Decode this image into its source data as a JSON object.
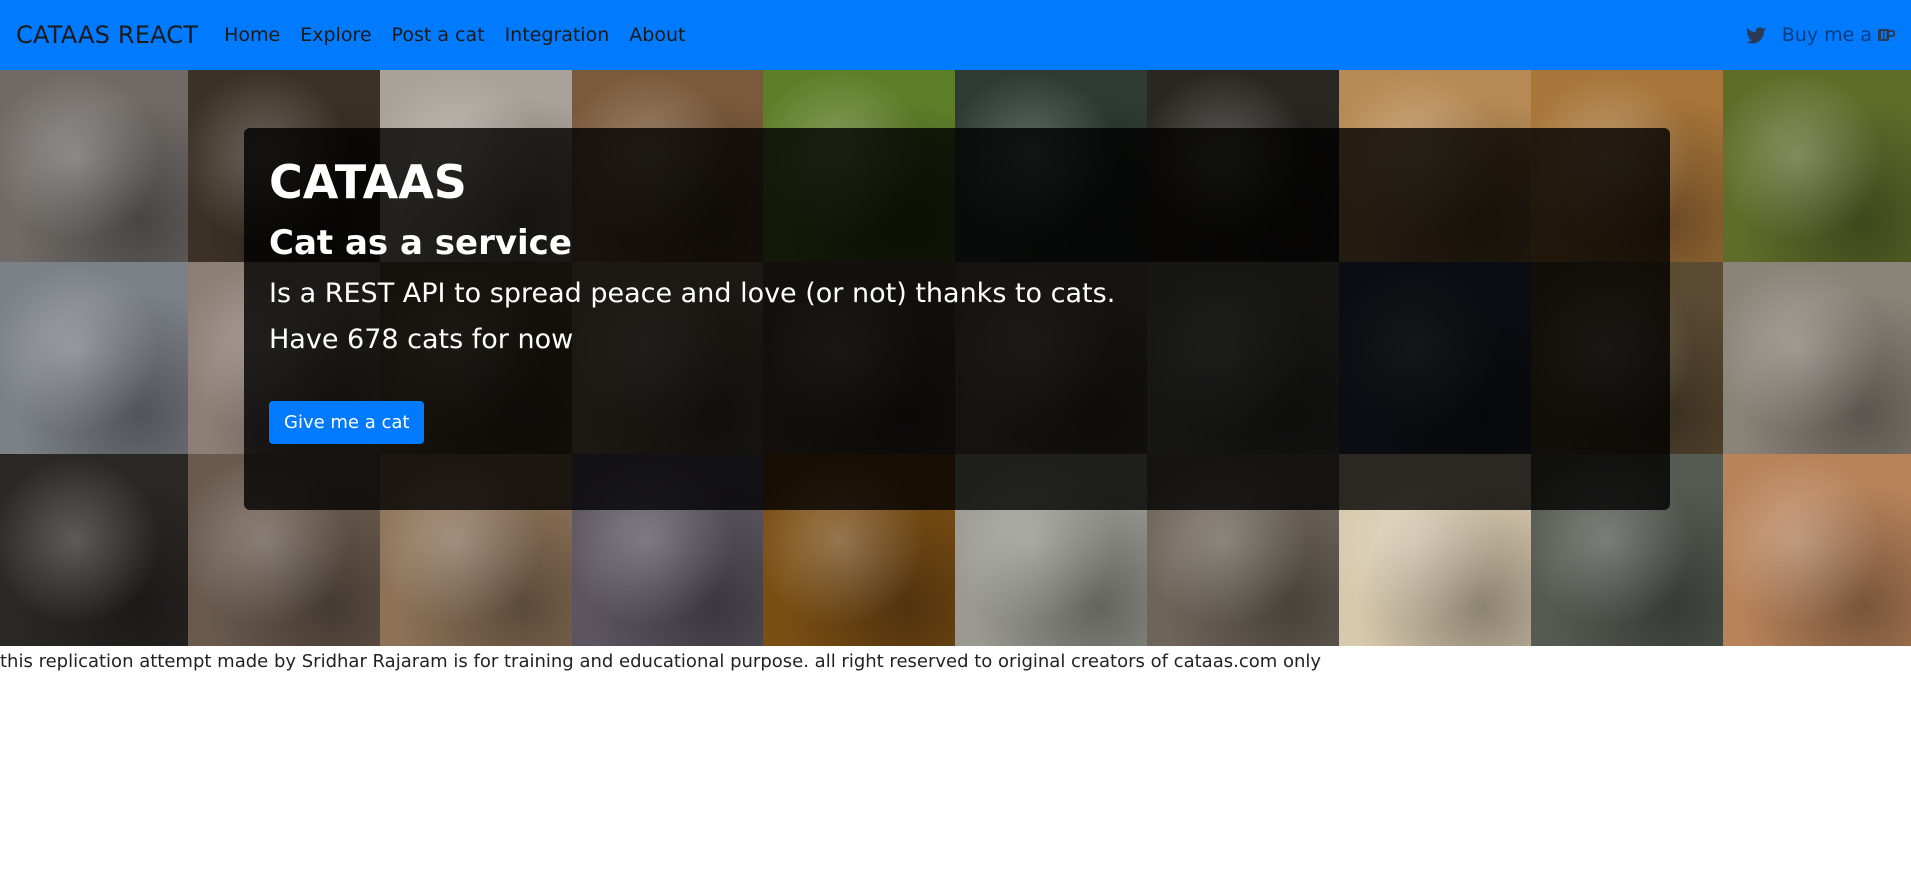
{
  "navbar": {
    "brand": "CATAAS REACT",
    "links": [
      "Home",
      "Explore",
      "Post a cat",
      "Integration",
      "About"
    ],
    "buy_label": "Buy me a",
    "twitter_icon": "twitter-icon",
    "coffee_icon": "kofi-icon",
    "background": "#007bff"
  },
  "mosaic": {
    "tiles": [
      "#6f6a66",
      "#3b3126",
      "#a9a29a",
      "#7a5a3c",
      "#5e7f2a",
      "#2e3a33",
      "#2a2622",
      "#b78a55",
      "#a8753a",
      "#5f6d2a",
      "#7c8187",
      "#8d7f76",
      "#6b5a3c",
      "#8a7a62",
      "#5a4a48",
      "#6d5d52",
      "#6f6e69",
      "#344258",
      "#5d4c34",
      "#8a8378",
      "#2a2825",
      "#6a5a4e",
      "#8d7258",
      "#5c5560",
      "#7b4e14",
      "#9a9a93",
      "#6e655a",
      "#d7c9ad",
      "#555a52",
      "#b9835a"
    ]
  },
  "hero": {
    "title": "CATAAS",
    "subtitle": "Cat as a service",
    "description": "Is a REST API to spread peace and love (or not) thanks to cats.",
    "count_text": "Have 678 cats for now",
    "button_label": "Give me a cat",
    "accent": "#007bff"
  },
  "footer": {
    "note": "this replication attempt made by Sridhar Rajaram is for training and educational purpose. all right reserved to original creators of cataas.com only"
  }
}
